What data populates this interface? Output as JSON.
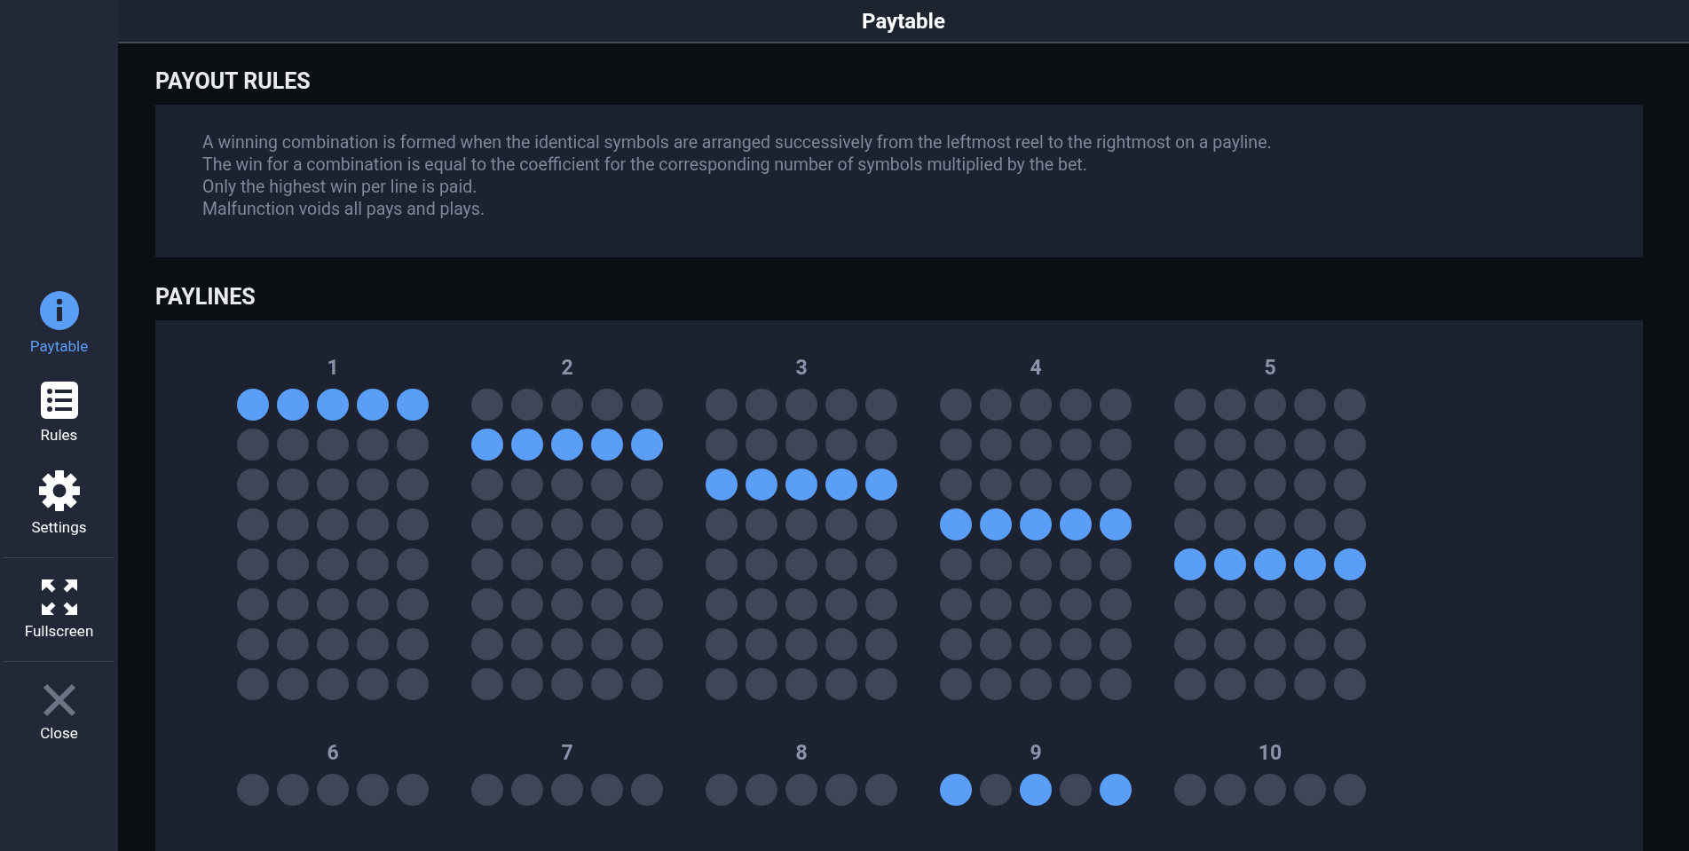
{
  "header": {
    "title": "Paytable"
  },
  "sidebar": {
    "groups": [
      [
        {
          "kind": "info",
          "label": "Paytable",
          "selected": true
        },
        {
          "kind": "list",
          "label": "Rules",
          "selected": false
        },
        {
          "kind": "gear",
          "label": "Settings",
          "selected": false
        }
      ],
      [
        {
          "kind": "fullscreen",
          "label": "Fullscreen",
          "selected": false
        }
      ],
      [
        {
          "kind": "close",
          "label": "Close",
          "selected": false
        }
      ]
    ]
  },
  "payout_rules": {
    "heading": "PAYOUT RULES",
    "lines": [
      "A winning combination is formed when the identical symbols are arranged successively from the leftmost reel to the rightmost on a payline.",
      "The win for a combination is equal to the coefficient for the corresponding number of symbols multiplied by the bet.",
      "Only the highest win per line is paid.",
      "Malfunction voids all pays and plays."
    ]
  },
  "paylines": {
    "heading": "PAYLINES",
    "lines": [
      {
        "number": "1",
        "rows": [
          [
            true,
            true,
            true,
            true,
            true
          ],
          [
            false,
            false,
            false,
            false,
            false
          ],
          [
            false,
            false,
            false,
            false,
            false
          ],
          [
            false,
            false,
            false,
            false,
            false
          ],
          [
            false,
            false,
            false,
            false,
            false
          ],
          [
            false,
            false,
            false,
            false,
            false
          ],
          [
            false,
            false,
            false,
            false,
            false
          ],
          [
            false,
            false,
            false,
            false,
            false
          ]
        ]
      },
      {
        "number": "2",
        "rows": [
          [
            false,
            false,
            false,
            false,
            false
          ],
          [
            true,
            true,
            true,
            true,
            true
          ],
          [
            false,
            false,
            false,
            false,
            false
          ],
          [
            false,
            false,
            false,
            false,
            false
          ],
          [
            false,
            false,
            false,
            false,
            false
          ],
          [
            false,
            false,
            false,
            false,
            false
          ],
          [
            false,
            false,
            false,
            false,
            false
          ],
          [
            false,
            false,
            false,
            false,
            false
          ]
        ]
      },
      {
        "number": "3",
        "rows": [
          [
            false,
            false,
            false,
            false,
            false
          ],
          [
            false,
            false,
            false,
            false,
            false
          ],
          [
            true,
            true,
            true,
            true,
            true
          ],
          [
            false,
            false,
            false,
            false,
            false
          ],
          [
            false,
            false,
            false,
            false,
            false
          ],
          [
            false,
            false,
            false,
            false,
            false
          ],
          [
            false,
            false,
            false,
            false,
            false
          ],
          [
            false,
            false,
            false,
            false,
            false
          ]
        ]
      },
      {
        "number": "4",
        "rows": [
          [
            false,
            false,
            false,
            false,
            false
          ],
          [
            false,
            false,
            false,
            false,
            false
          ],
          [
            false,
            false,
            false,
            false,
            false
          ],
          [
            true,
            true,
            true,
            true,
            true
          ],
          [
            false,
            false,
            false,
            false,
            false
          ],
          [
            false,
            false,
            false,
            false,
            false
          ],
          [
            false,
            false,
            false,
            false,
            false
          ],
          [
            false,
            false,
            false,
            false,
            false
          ]
        ]
      },
      {
        "number": "5",
        "rows": [
          [
            false,
            false,
            false,
            false,
            false
          ],
          [
            false,
            false,
            false,
            false,
            false
          ],
          [
            false,
            false,
            false,
            false,
            false
          ],
          [
            false,
            false,
            false,
            false,
            false
          ],
          [
            true,
            true,
            true,
            true,
            true
          ],
          [
            false,
            false,
            false,
            false,
            false
          ],
          [
            false,
            false,
            false,
            false,
            false
          ],
          [
            false,
            false,
            false,
            false,
            false
          ]
        ]
      },
      {
        "number": "6",
        "rows": [
          [
            false,
            false,
            false,
            false,
            false
          ]
        ]
      },
      {
        "number": "7",
        "rows": [
          [
            false,
            false,
            false,
            false,
            false
          ]
        ]
      },
      {
        "number": "8",
        "rows": [
          [
            false,
            false,
            false,
            false,
            false
          ]
        ]
      },
      {
        "number": "9",
        "rows": [
          [
            true,
            false,
            true,
            false,
            true
          ]
        ]
      },
      {
        "number": "10",
        "rows": [
          [
            false,
            false,
            false,
            false,
            false
          ]
        ]
      }
    ]
  }
}
